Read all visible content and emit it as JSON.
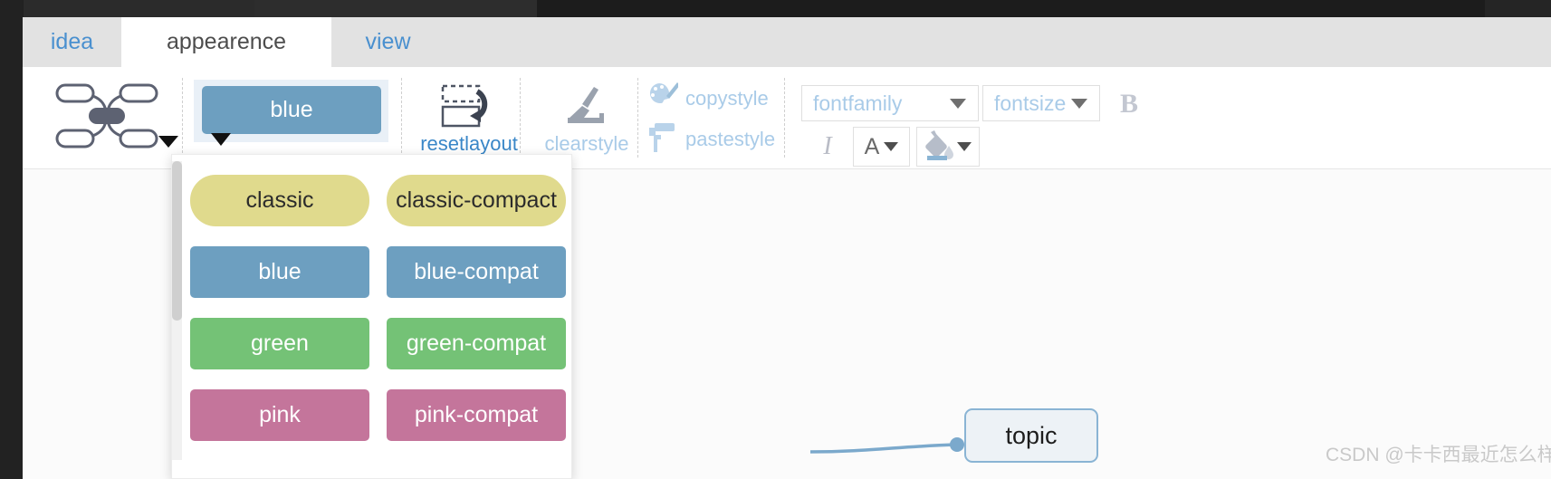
{
  "window": {
    "tabs": [
      {
        "id": "idea",
        "label": "idea",
        "active": false
      },
      {
        "id": "appearence",
        "label": "appearence",
        "active": true
      },
      {
        "id": "view",
        "label": "view",
        "active": false
      }
    ]
  },
  "toolbar": {
    "layout_button": {
      "icon": "mindmap-layout-icon",
      "caret": "chevron-down-icon"
    },
    "theme_button": {
      "label": "blue",
      "color": "#6d9fc0",
      "caret": "chevron-down-icon"
    },
    "reset_layout": {
      "label": "resetlayout",
      "icon": "reset-layout-icon",
      "color": "#3a87c8",
      "enabled": true
    },
    "clear_style": {
      "label": "clearstyle",
      "icon": "brush-icon",
      "color": "#a9cbe8",
      "enabled": false
    },
    "copy_style": {
      "label": "copystyle",
      "icon": "palette-brush-icon",
      "color": "#a9cbe8",
      "enabled": false
    },
    "paste_style": {
      "label": "pastestyle",
      "icon": "paint-roller-icon",
      "color": "#a9cbe8",
      "enabled": false
    },
    "font_family": {
      "placeholder": "fontfamily",
      "value": "",
      "caret": "chevron-down-icon"
    },
    "font_size": {
      "placeholder": "fontsize",
      "value": "",
      "caret": "chevron-down-icon"
    },
    "bold": {
      "label": "B",
      "enabled": false
    },
    "italic": {
      "label": "I",
      "enabled": false
    },
    "text_color": {
      "label": "A",
      "icon": "text-color-icon",
      "caret": "chevron-down-icon"
    },
    "fill_color": {
      "icon": "paint-bucket-icon",
      "caret": "chevron-down-icon",
      "swatch": "#8ab4d4"
    }
  },
  "theme_panel": {
    "open": true,
    "items": [
      {
        "label": "classic",
        "bg": "#e0da8d",
        "fg": "#2b2b2b",
        "radius": "28px"
      },
      {
        "label": "classic-compact",
        "bg": "#e0da8d",
        "fg": "#2b2b2b",
        "radius": "28px"
      },
      {
        "label": "blue",
        "bg": "#6d9fc0",
        "fg": "#ffffff",
        "radius": "5px"
      },
      {
        "label": "blue-compat",
        "bg": "#6d9fc0",
        "fg": "#ffffff",
        "radius": "5px"
      },
      {
        "label": "green",
        "bg": "#74c276",
        "fg": "#ffffff",
        "radius": "5px"
      },
      {
        "label": "green-compat",
        "bg": "#74c276",
        "fg": "#ffffff",
        "radius": "5px"
      },
      {
        "label": "pink",
        "bg": "#c4759b",
        "fg": "#ffffff",
        "radius": "5px"
      },
      {
        "label": "pink-compat",
        "bg": "#c4759b",
        "fg": "#ffffff",
        "radius": "5px"
      }
    ]
  },
  "canvas": {
    "nodes": [
      {
        "label": "topic",
        "border": "#8ab4d4",
        "bg": "#edf2f6"
      }
    ],
    "connector_color": "#7ba9cc"
  },
  "watermark": {
    "text": "CSDN @卡卡西最近怎么样"
  }
}
